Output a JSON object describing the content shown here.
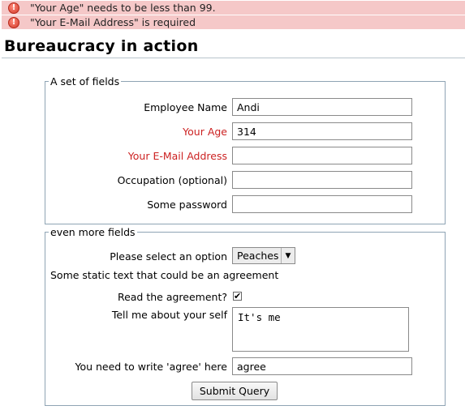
{
  "errors": [
    {
      "text": "\"Your Age\" needs to be less than 99."
    },
    {
      "text": "\"Your E-Mail Address\" is required"
    }
  ],
  "page": {
    "title": "Bureaucracy in action"
  },
  "fieldset1": {
    "legend": "A set of fields",
    "fields": [
      {
        "label": "Employee Name",
        "value": "Andi",
        "required": false
      },
      {
        "label": "Your Age",
        "value": "314",
        "required": true
      },
      {
        "label": "Your E-Mail Address",
        "value": "",
        "required": true
      },
      {
        "label": "Occupation (optional)",
        "value": "",
        "required": false
      },
      {
        "label": "Some password",
        "value": "",
        "required": false
      }
    ]
  },
  "fieldset2": {
    "legend": "even more fields",
    "select_label": "Please select an option",
    "select_value": "Peaches",
    "static_text": "Some static text that could be an agreement",
    "checkbox_label": "Read the agreement?",
    "checkbox_checked": true,
    "textarea_label": "Tell me about your self",
    "textarea_value": "It's me",
    "agree_label": "You need to write 'agree' here",
    "agree_value": "agree",
    "submit_label": "Submit Query"
  },
  "colors": {
    "error_bg": "#f5c8c8",
    "required_label": "#cc2222",
    "fieldset_border": "#8fa4b4"
  }
}
